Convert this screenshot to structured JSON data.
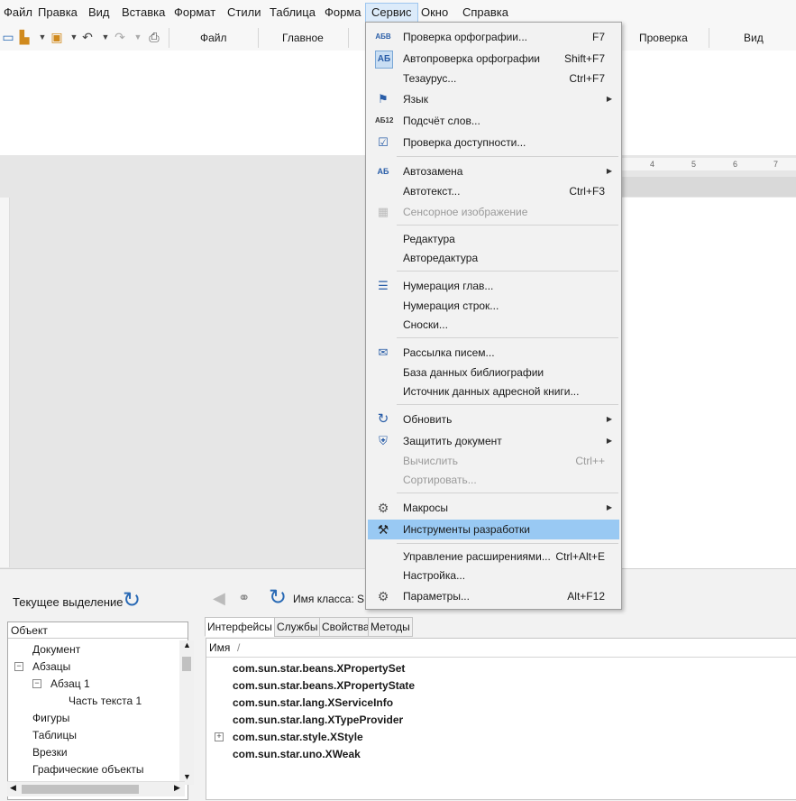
{
  "menubar": {
    "items": [
      "Файл",
      "Правка",
      "Вид",
      "Вставка",
      "Формат",
      "Стили",
      "Таблица",
      "Форма",
      "Сервис",
      "Окно",
      "Справка"
    ],
    "active": "Сервис"
  },
  "toolbar": {
    "tabs": [
      "Файл",
      "Главное",
      "Проверка",
      "Вид"
    ]
  },
  "ruler": {
    "ticks": [
      "4",
      "5",
      "6",
      "7"
    ]
  },
  "bottom": {
    "current_selection": "Текущее выделение",
    "class_label": "Имя класса:",
    "class_value": "S",
    "tree_header": "Объект",
    "tree_items": [
      "Документ",
      "Абзацы",
      "Абзац 1",
      "Часть текста 1",
      "Фигуры",
      "Таблицы",
      "Врезки",
      "Графические объекты"
    ],
    "tabs": [
      "Интерфейсы",
      "Службы",
      "Свойства",
      "Методы"
    ],
    "list_header": "Имя",
    "sort_marker": "/",
    "interfaces": [
      "com.sun.star.beans.XPropertySet",
      "com.sun.star.beans.XPropertyState",
      "com.sun.star.lang.XServiceInfo",
      "com.sun.star.lang.XTypeProvider",
      "com.sun.star.style.XStyle",
      "com.sun.star.uno.XWeak"
    ]
  },
  "menu": {
    "items": [
      {
        "label": "Проверка орфографии...",
        "shortcut": "F7",
        "icon": "ABC-check"
      },
      {
        "label": "Автопроверка орфографии",
        "shortcut": "Shift+F7",
        "icon": "АБ"
      },
      {
        "label": "Тезаурус...",
        "shortcut": "Ctrl+F7",
        "icon": ""
      },
      {
        "label": "Язык",
        "shortcut": "",
        "icon": "flag"
      },
      {
        "label": "Подсчёт слов...",
        "shortcut": "",
        "icon": "АБ12"
      },
      {
        "label": "Проверка доступности...",
        "shortcut": "",
        "icon": "check-doc"
      },
      {
        "label": "Автозамена",
        "shortcut": "",
        "icon": "АБ"
      },
      {
        "label": "Автотекст...",
        "shortcut": "Ctrl+F3",
        "icon": ""
      },
      {
        "label": "Сенсорное изображение",
        "shortcut": "",
        "icon": "image-map"
      },
      {
        "label": "Редактура",
        "shortcut": "",
        "icon": ""
      },
      {
        "label": "Автоpедактура",
        "shortcut": "",
        "icon": ""
      },
      {
        "label": "Нумерация глав...",
        "shortcut": "",
        "icon": "numbering"
      },
      {
        "label": "Нумерация строк...",
        "shortcut": "",
        "icon": ""
      },
      {
        "label": "Сноски...",
        "shortcut": "",
        "icon": ""
      },
      {
        "label": "Рассылка писем...",
        "shortcut": "",
        "icon": "mail-merge"
      },
      {
        "label": "База данных библиографии",
        "shortcut": "",
        "icon": ""
      },
      {
        "label": "Источник данных адресной книги...",
        "shortcut": "",
        "icon": ""
      },
      {
        "label": "Обновить",
        "shortcut": "",
        "icon": "refresh"
      },
      {
        "label": "Защитить документ",
        "shortcut": "",
        "icon": "shield"
      },
      {
        "label": "Вычислить",
        "shortcut": "Ctrl++",
        "icon": ""
      },
      {
        "label": "Сортировать...",
        "shortcut": "",
        "icon": ""
      },
      {
        "label": "Макросы",
        "shortcut": "",
        "icon": "gear"
      },
      {
        "label": "Инструменты разработки",
        "shortcut": "",
        "icon": "hammer"
      },
      {
        "label": "Управление расширениями...",
        "shortcut": "Ctrl+Alt+E",
        "icon": ""
      },
      {
        "label": "Настройка...",
        "shortcut": "",
        "icon": ""
      },
      {
        "label": "Параметры...",
        "shortcut": "Alt+F12",
        "icon": "gear"
      }
    ]
  }
}
